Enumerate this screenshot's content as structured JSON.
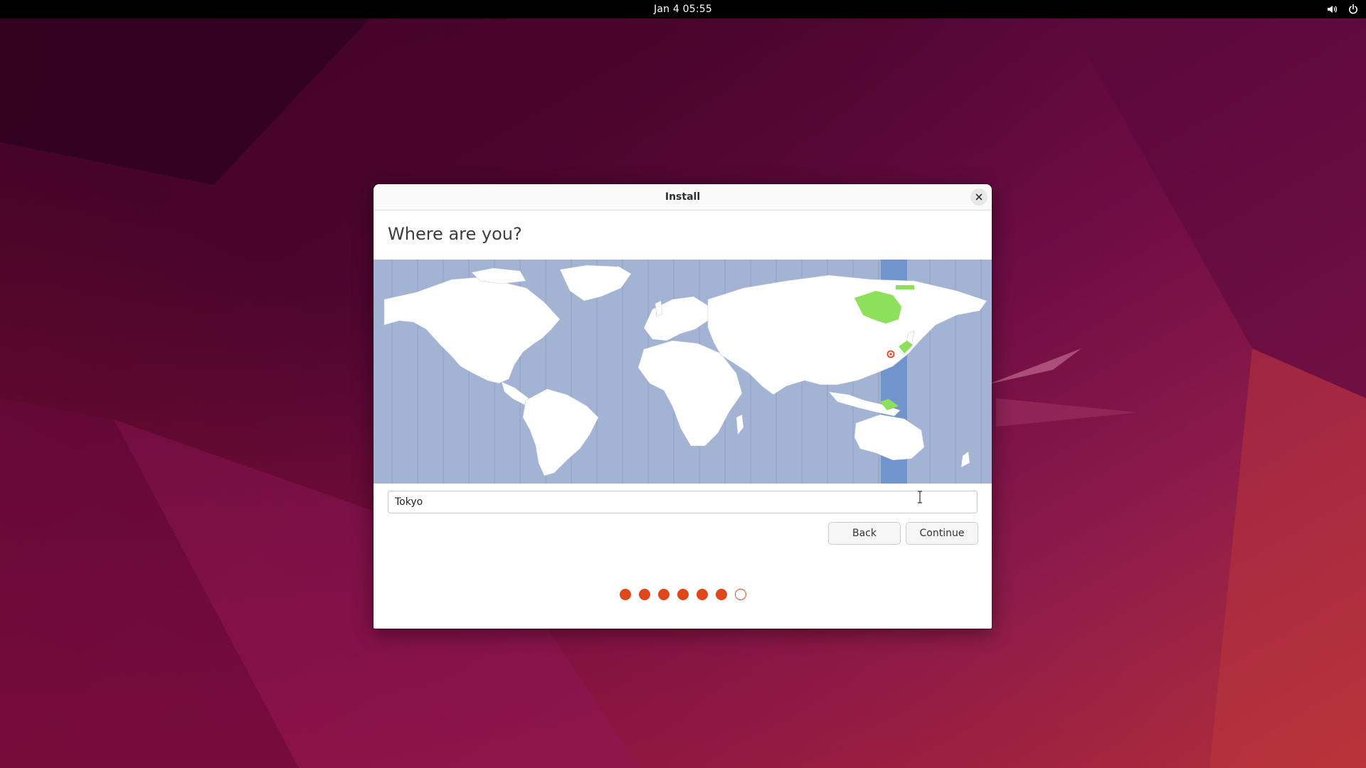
{
  "topbar": {
    "clock": "Jan 4  05:55",
    "icons": [
      "volume-icon",
      "power-icon"
    ]
  },
  "window": {
    "title": "Install",
    "close_icon": "close-icon"
  },
  "page": {
    "heading": "Where are you?"
  },
  "map": {
    "selected_city": "Tokyo",
    "colors": {
      "ocean": "#a3b3d3",
      "land": "#ffffff",
      "highlighted_timezone_band": "#7094cc",
      "highlighted_region": "#8de05a",
      "pin": "#e0461c"
    }
  },
  "location": {
    "value": "Tokyo"
  },
  "buttons": {
    "back": "Back",
    "continue": "Continue"
  },
  "progress": {
    "total_steps": 7,
    "completed_steps": 6,
    "accent": "#e0461c"
  }
}
